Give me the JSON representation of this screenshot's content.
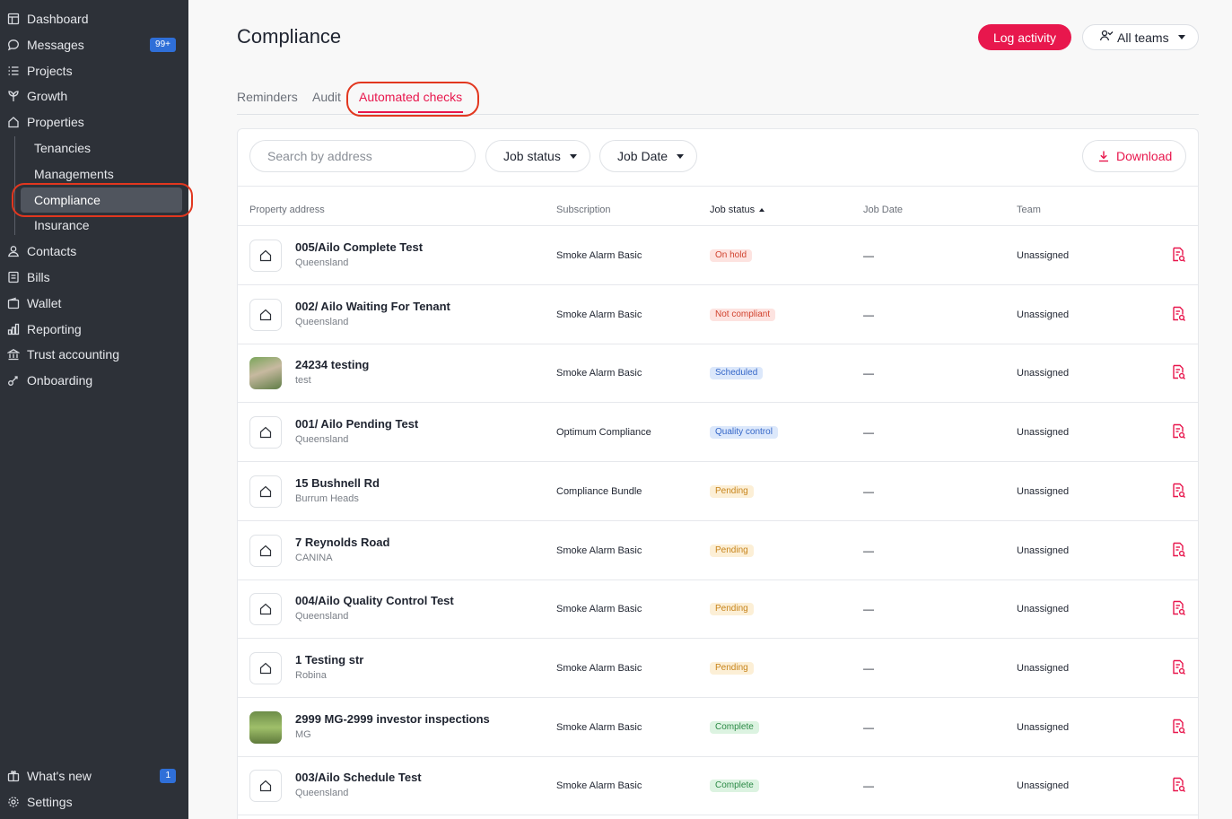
{
  "sidebar": {
    "items": [
      {
        "label": "Dashboard",
        "icon": "dashboard-icon"
      },
      {
        "label": "Messages",
        "icon": "message-icon",
        "badge": "99+"
      },
      {
        "label": "Projects",
        "icon": "list-icon"
      },
      {
        "label": "Growth",
        "icon": "sprout-icon"
      },
      {
        "label": "Properties",
        "icon": "house-icon"
      },
      {
        "label": "Contacts",
        "icon": "person-icon"
      },
      {
        "label": "Bills",
        "icon": "bill-icon"
      },
      {
        "label": "Wallet",
        "icon": "wallet-icon"
      },
      {
        "label": "Reporting",
        "icon": "chart-icon"
      },
      {
        "label": "Trust accounting",
        "icon": "bank-icon"
      },
      {
        "label": "Onboarding",
        "icon": "onboarding-icon"
      }
    ],
    "subitems": [
      "Tenancies",
      "Managements",
      "Compliance",
      "Insurance"
    ],
    "footer": [
      {
        "label": "What's new",
        "icon": "globe-icon",
        "badge": "1"
      },
      {
        "label": "Settings",
        "icon": "gear-icon"
      }
    ]
  },
  "header": {
    "title": "Compliance",
    "log_activity": "Log activity",
    "teams": "All teams"
  },
  "tabs": [
    "Reminders",
    "Audit",
    "Automated checks"
  ],
  "toolbar": {
    "search_placeholder": "Search by address",
    "job_status": "Job status",
    "job_date": "Job Date",
    "download": "Download"
  },
  "table": {
    "columns": [
      "Property address",
      "Subscription",
      "Job status",
      "Job Date",
      "Team"
    ],
    "rows": [
      {
        "address": "005/Ailo Complete Test",
        "region": "Queensland",
        "subscription": "Smoke Alarm Basic",
        "status": "On hold",
        "date": "—",
        "team": "Unassigned",
        "thumb": "house"
      },
      {
        "address": "002/ Ailo Waiting For Tenant",
        "region": "Queensland",
        "subscription": "Smoke Alarm Basic",
        "status": "Not compliant",
        "date": "—",
        "team": "Unassigned",
        "thumb": "house"
      },
      {
        "address": "24234 testing",
        "region": "test",
        "subscription": "Smoke Alarm Basic",
        "status": "Scheduled",
        "date": "—",
        "team": "Unassigned",
        "thumb": "photo1"
      },
      {
        "address": "001/ Ailo Pending Test",
        "region": "Queensland",
        "subscription": "Optimum Compliance",
        "status": "Quality control",
        "date": "—",
        "team": "Unassigned",
        "thumb": "house"
      },
      {
        "address": "15 Bushnell Rd",
        "region": "Burrum Heads",
        "subscription": "Compliance Bundle",
        "status": "Pending",
        "date": "—",
        "team": "Unassigned",
        "thumb": "house"
      },
      {
        "address": "7 Reynolds Road",
        "region": "CANINA",
        "subscription": "Smoke Alarm Basic",
        "status": "Pending",
        "date": "—",
        "team": "Unassigned",
        "thumb": "house"
      },
      {
        "address": "004/Ailo Quality Control Test",
        "region": "Queensland",
        "subscription": "Smoke Alarm Basic",
        "status": "Pending",
        "date": "—",
        "team": "Unassigned",
        "thumb": "house"
      },
      {
        "address": "1 Testing str",
        "region": "Robina",
        "subscription": "Smoke Alarm Basic",
        "status": "Pending",
        "date": "—",
        "team": "Unassigned",
        "thumb": "house"
      },
      {
        "address": "2999 MG-2999 investor inspections",
        "region": "MG",
        "subscription": "Smoke Alarm Basic",
        "status": "Complete",
        "date": "—",
        "team": "Unassigned",
        "thumb": "photo2"
      },
      {
        "address": "003/Ailo Schedule Test",
        "region": "Queensland",
        "subscription": "Smoke Alarm Basic",
        "status": "Complete",
        "date": "—",
        "team": "Unassigned",
        "thumb": "house"
      }
    ]
  },
  "status_colors": {
    "On hold": {
      "bg": "#fde3e0",
      "fg": "#d1432f"
    },
    "Not compliant": {
      "bg": "#fde3e0",
      "fg": "#d1432f"
    },
    "Scheduled": {
      "bg": "#dce8fb",
      "fg": "#3567c8"
    },
    "Quality control": {
      "bg": "#dce8fb",
      "fg": "#3567c8"
    },
    "Pending": {
      "bg": "#fcefd6",
      "fg": "#c7841c"
    },
    "Complete": {
      "bg": "#dcf3e1",
      "fg": "#2c8a46"
    }
  },
  "colors": {
    "accent": "#e8174d",
    "sidebar_bg": "#2d3138",
    "annotation": "#e2371f"
  }
}
